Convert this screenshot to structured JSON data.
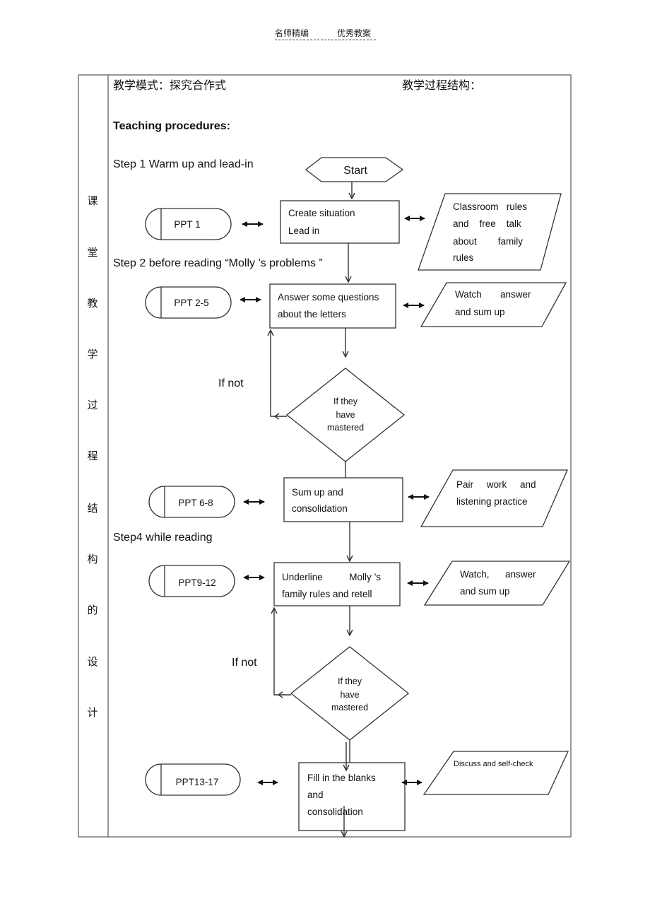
{
  "header": {
    "left": "名师精编",
    "right": "优秀教案"
  },
  "table": {
    "side_label_chars": [
      "课",
      "堂",
      "教",
      "学",
      "过",
      "程",
      "结",
      "构",
      "的",
      "设",
      "计"
    ],
    "mode_label": "教学模式：探究合作式",
    "structure_label": "教学过程结构：",
    "procedures_title": "Teaching procedures:"
  },
  "steps": {
    "step1": "Step 1 Warm up and lead-in",
    "step2": "Step 2 before reading “Molly ’s problems ”",
    "step4": "Step4 while reading"
  },
  "flow": {
    "start": "Start",
    "if_not_1": "If not",
    "if_not_2": "If not",
    "rows": [
      {
        "ppt": "PPT 1",
        "process": [
          "Create situation",
          "Lead in"
        ],
        "io": [
          "Classroom   rules",
          "and    free    talk",
          "about        family",
          "rules"
        ]
      },
      {
        "ppt": "PPT 2-5",
        "process": [
          "Answer some questions",
          "about the letters"
        ],
        "io": [
          "Watch       answer",
          "and sum up"
        ]
      },
      {
        "ppt": "PPT 6-8",
        "process": [
          "Sum up and",
          "consolidation"
        ],
        "io": [
          "Pair     work     and",
          "listening practice"
        ]
      },
      {
        "ppt": "PPT9-12",
        "process": [
          "Underline          Molly ’s",
          "family rules and retell"
        ],
        "io": [
          "Watch,      answer",
          "and sum up"
        ]
      },
      {
        "ppt": "PPT13-17",
        "process": [
          "Fill in the blanks",
          "and",
          "consolidation"
        ],
        "io": [
          "Discuss and self-check"
        ]
      }
    ],
    "decision_1": [
      "If they",
      "have",
      "mastered"
    ],
    "decision_2": [
      "If they",
      "have",
      "mastered"
    ]
  }
}
